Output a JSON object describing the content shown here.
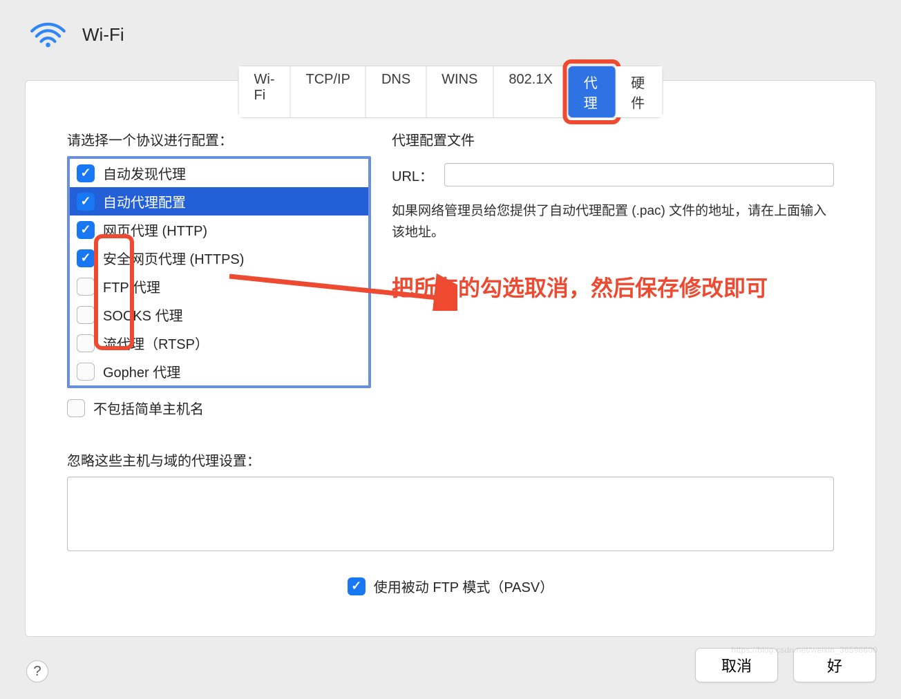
{
  "header": {
    "title": "Wi-Fi"
  },
  "tabs": [
    {
      "label": "Wi-Fi"
    },
    {
      "label": "TCP/IP"
    },
    {
      "label": "DNS"
    },
    {
      "label": "WINS"
    },
    {
      "label": "802.1X"
    },
    {
      "label": "代理"
    },
    {
      "label": "硬件"
    }
  ],
  "active_tab_index": 5,
  "left": {
    "section_label": "请选择一个协议进行配置：",
    "protocols": [
      {
        "label": "自动发现代理",
        "checked": true,
        "selected": false
      },
      {
        "label": "自动代理配置",
        "checked": true,
        "selected": true
      },
      {
        "label": "网页代理 (HTTP)",
        "checked": true,
        "selected": false
      },
      {
        "label": "安全网页代理 (HTTPS)",
        "checked": true,
        "selected": false
      },
      {
        "label": "FTP 代理",
        "checked": false,
        "selected": false
      },
      {
        "label": "SOCKS 代理",
        "checked": false,
        "selected": false
      },
      {
        "label": "流代理（RTSP）",
        "checked": false,
        "selected": false
      },
      {
        "label": "Gopher 代理",
        "checked": false,
        "selected": false
      }
    ],
    "exclude_simple": {
      "label": "不包括简单主机名",
      "checked": false
    }
  },
  "right": {
    "title": "代理配置文件",
    "url_label": "URL：",
    "url_value": "",
    "desc": "如果网络管理员给您提供了自动代理配置 (.pac) 文件的地址，请在上面输入该地址。"
  },
  "annotation": "把所有的勾选取消，然后保存修改即可",
  "bypass": {
    "label": "忽略这些主机与域的代理设置：",
    "value": ""
  },
  "pasv": {
    "label": "使用被动 FTP 模式（PASV）",
    "checked": true
  },
  "buttons": {
    "cancel": "取消",
    "ok": "好"
  },
  "watermark": "https://blog.csdn.net/weixin_36598600"
}
